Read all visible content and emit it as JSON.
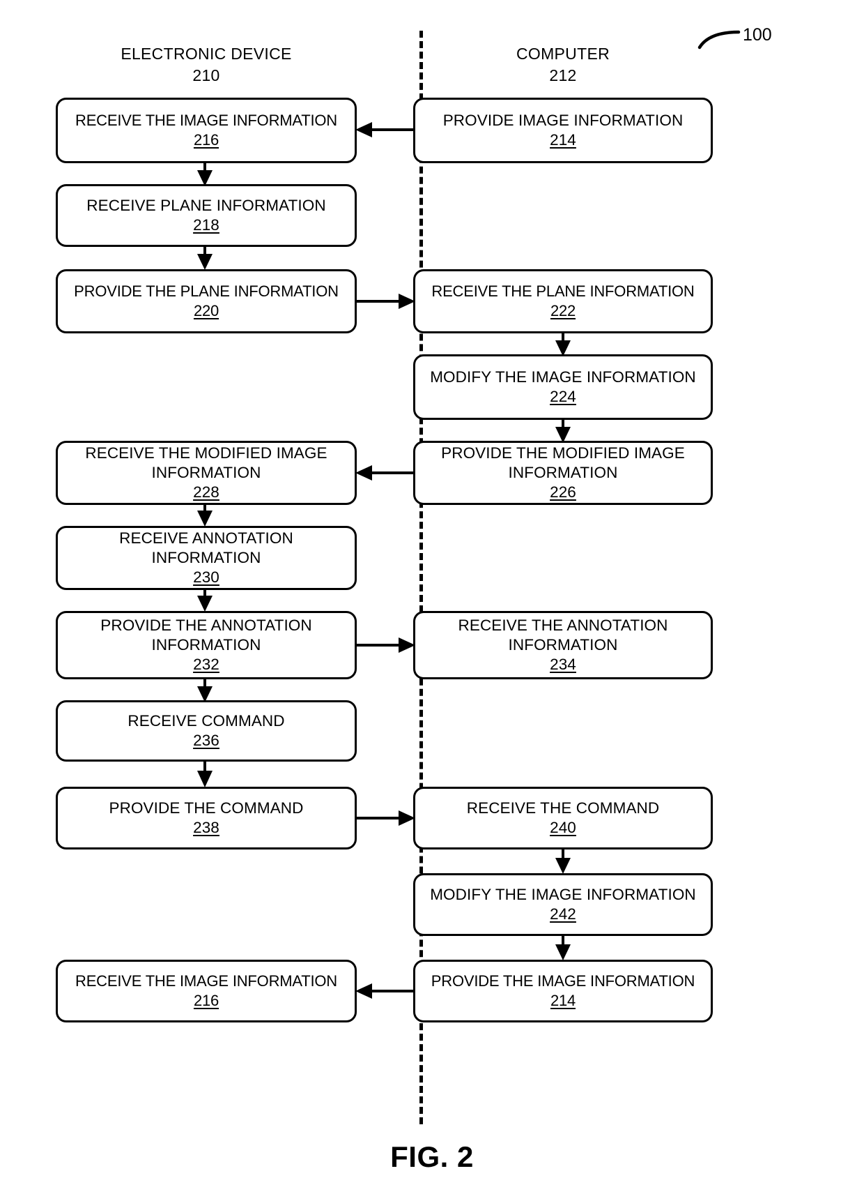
{
  "figure": {
    "caption": "FIG. 2",
    "reference_numeral": "100"
  },
  "columns": [
    {
      "title": "ELECTRONIC DEVICE",
      "number": "210"
    },
    {
      "title": "COMPUTER",
      "number": "212"
    }
  ],
  "steps": {
    "s216a": {
      "label": "RECEIVE THE IMAGE INFORMATION",
      "number": "216"
    },
    "s214a": {
      "label": "PROVIDE IMAGE INFORMATION",
      "number": "214"
    },
    "s218": {
      "label": "RECEIVE PLANE INFORMATION",
      "number": "218"
    },
    "s220": {
      "label": "PROVIDE THE PLANE INFORMATION",
      "number": "220"
    },
    "s222": {
      "label": "RECEIVE THE PLANE INFORMATION",
      "number": "222"
    },
    "s224": {
      "label": "MODIFY THE IMAGE INFORMATION",
      "number": "224"
    },
    "s228": {
      "label": "RECEIVE THE MODIFIED IMAGE\nINFORMATION",
      "number": "228"
    },
    "s226": {
      "label": "PROVIDE THE MODIFIED IMAGE\nINFORMATION",
      "number": "226"
    },
    "s230": {
      "label": "RECEIVE ANNOTATION\nINFORMATION",
      "number": "230"
    },
    "s232": {
      "label": "PROVIDE THE ANNOTATION\nINFORMATION",
      "number": "232"
    },
    "s234": {
      "label": "RECEIVE THE ANNOTATION\nINFORMATION",
      "number": "234"
    },
    "s236": {
      "label": "RECEIVE COMMAND",
      "number": "236"
    },
    "s238": {
      "label": "PROVIDE THE COMMAND",
      "number": "238"
    },
    "s240": {
      "label": "RECEIVE THE COMMAND",
      "number": "240"
    },
    "s242": {
      "label": "MODIFY THE IMAGE INFORMATION",
      "number": "242"
    },
    "s216b": {
      "label": "RECEIVE THE IMAGE INFORMATION",
      "number": "216"
    },
    "s214b": {
      "label": "PROVIDE THE IMAGE INFORMATION",
      "number": "214"
    }
  },
  "colors": {
    "stroke": "#000000",
    "background": "#ffffff"
  }
}
